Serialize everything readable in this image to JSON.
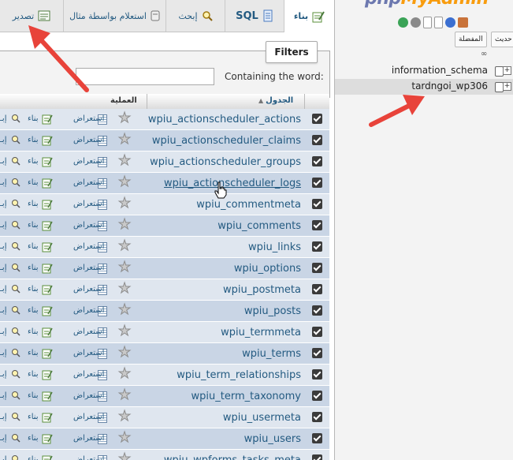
{
  "tabs": [
    {
      "label": "بناء",
      "icon": "structure-icon",
      "active": true
    },
    {
      "label": "SQL",
      "icon": "sql-icon",
      "active": false
    },
    {
      "label": "إبحث",
      "icon": "search-icon",
      "active": false
    },
    {
      "label": "استعلام بواسطة مثال",
      "icon": "query-icon",
      "active": false
    },
    {
      "label": "تصدير",
      "icon": "export-icon",
      "active": false
    }
  ],
  "filters": {
    "legend": "Filters",
    "label": "Containing the word:",
    "value": ""
  },
  "table_header": {
    "table_col": "الجدول",
    "op_col": "العملية"
  },
  "row_actions": {
    "browse": "استعراض",
    "structure": "بناء",
    "search": "إبـ"
  },
  "tables": [
    "wpiu_actionscheduler_actions",
    "wpiu_actionscheduler_claims",
    "wpiu_actionscheduler_groups",
    "wpiu_actionscheduler_logs",
    "wpiu_commentmeta",
    "wpiu_comments",
    "wpiu_links",
    "wpiu_options",
    "wpiu_postmeta",
    "wpiu_posts",
    "wpiu_termmeta",
    "wpiu_terms",
    "wpiu_term_relationships",
    "wpiu_term_taxonomy",
    "wpiu_usermeta",
    "wpiu_users",
    "wpiu_wpforms_tasks_meta"
  ],
  "hovered_row": 3,
  "nav": {
    "logo_part1": "php",
    "logo_part2": "MyAdmin",
    "favorites_label": "المفضلة",
    "refresh_label": "حديث",
    "databases": [
      {
        "name": "information_schema",
        "selected": false
      },
      {
        "name": "tardngoi_wp306",
        "selected": true
      }
    ]
  },
  "colors": {
    "link": "#235a81",
    "row_odd": "#dfe6ef",
    "row_even": "#c9d5e5",
    "arrow": "#e8433a"
  }
}
